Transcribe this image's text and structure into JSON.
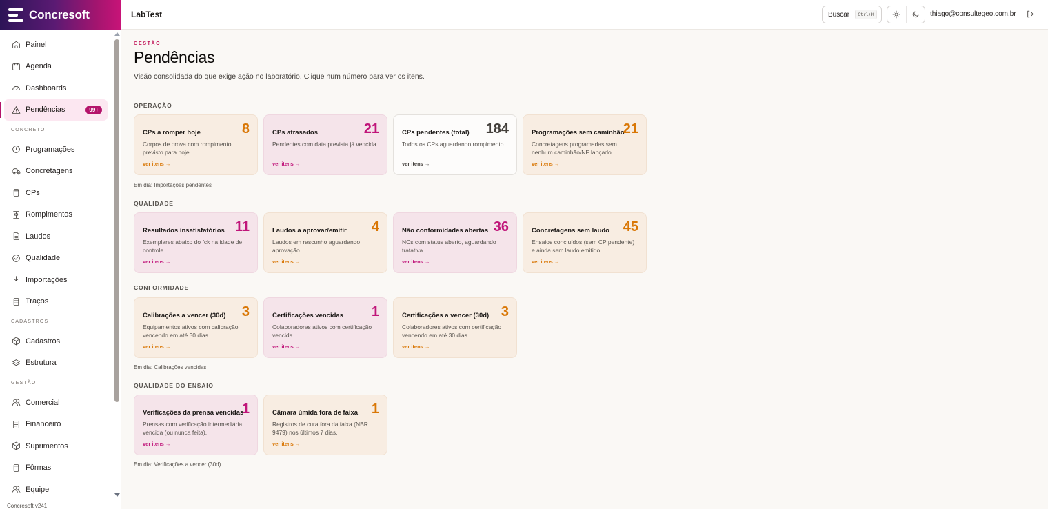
{
  "brand": {
    "name": "Concresoft"
  },
  "topbar": {
    "app_title": "LabTest",
    "search_label": "Buscar",
    "search_shortcut": "Ctrl+K",
    "user_email": "thiago@consultegeo.com.br"
  },
  "sidebar": {
    "items_top": [
      {
        "label": "Painel",
        "icon": "home-icon"
      },
      {
        "label": "Agenda",
        "icon": "calendar-icon"
      },
      {
        "label": "Dashboards",
        "icon": "gauge-icon"
      },
      {
        "label": "Pendências",
        "icon": "alert-triangle-icon",
        "badge": "99+",
        "active": true
      }
    ],
    "section_concreto": "CONCRETO",
    "items_concreto": [
      {
        "label": "Programações",
        "icon": "clock-icon"
      },
      {
        "label": "Concretagens",
        "icon": "truck-icon"
      },
      {
        "label": "CPs",
        "icon": "cylinder-icon"
      },
      {
        "label": "Rompimentos",
        "icon": "press-icon"
      },
      {
        "label": "Laudos",
        "icon": "document-icon"
      },
      {
        "label": "Qualidade",
        "icon": "check-circle-icon"
      },
      {
        "label": "Importações",
        "icon": "download-icon"
      },
      {
        "label": "Traços",
        "icon": "columns-icon"
      }
    ],
    "section_cadastros": "CADASTROS",
    "items_cadastros": [
      {
        "label": "Cadastros",
        "icon": "box-icon"
      },
      {
        "label": "Estrutura",
        "icon": "layers-icon"
      }
    ],
    "section_gestao": "GESTÃO",
    "items_gestao": [
      {
        "label": "Comercial",
        "icon": "users-icon"
      },
      {
        "label": "Financeiro",
        "icon": "receipt-icon"
      },
      {
        "label": "Suprimentos",
        "icon": "package-icon"
      },
      {
        "label": "Fôrmas",
        "icon": "cylinder-icon"
      },
      {
        "label": "Equipe",
        "icon": "users-icon"
      }
    ],
    "version": "Concresoft v241"
  },
  "page": {
    "eyebrow": "GESTÃO",
    "title": "Pendências",
    "subtitle": "Visão consolidada do que exige ação no laboratório. Clique num número para ver os itens."
  },
  "sections": {
    "operacao": {
      "title": "OPERAÇÃO",
      "footnote": "Em dia: Importações pendentes",
      "cards": [
        {
          "title": "CPs a romper hoje",
          "value": "8",
          "desc": "Corpos de prova com rompimento previsto para hoje.",
          "link": "ver itens →",
          "tone": "orange"
        },
        {
          "title": "CPs atrasados",
          "value": "21",
          "desc": "Pendentes com data prevista já vencida.",
          "link": "ver itens →",
          "tone": "pink"
        },
        {
          "title": "CPs pendentes (total)",
          "value": "184",
          "desc": "Todos os CPs aguardando rompimento.",
          "link": "ver itens →",
          "tone": "white"
        },
        {
          "title": "Programações sem caminhão",
          "value": "21",
          "desc": "Concretagens programadas sem nenhum caminhão/NF lançado.",
          "link": "ver itens →",
          "tone": "orange"
        }
      ]
    },
    "qualidade": {
      "title": "QUALIDADE",
      "cards": [
        {
          "title": "Resultados insatisfatórios",
          "value": "11",
          "desc": "Exemplares abaixo do fck na idade de controle.",
          "link": "ver itens →",
          "tone": "pink"
        },
        {
          "title": "Laudos a aprovar/emitir",
          "value": "4",
          "desc": "Laudos em rascunho aguardando aprovação.",
          "link": "ver itens →",
          "tone": "orange"
        },
        {
          "title": "Não conformidades abertas",
          "value": "36",
          "desc": "NCs com status aberto, aguardando tratativa.",
          "link": "ver itens →",
          "tone": "pink"
        },
        {
          "title": "Concretagens sem laudo",
          "value": "45",
          "desc": "Ensaios concluídos (sem CP pendente) e ainda sem laudo emitido.",
          "link": "ver itens →",
          "tone": "orange"
        }
      ]
    },
    "conformidade": {
      "title": "CONFORMIDADE",
      "footnote": "Em dia: Calibrações vencidas",
      "cards": [
        {
          "title": "Calibrações a vencer (30d)",
          "value": "3",
          "desc": "Equipamentos ativos com calibração vencendo em até 30 dias.",
          "link": "ver itens →",
          "tone": "orange"
        },
        {
          "title": "Certificações vencidas",
          "value": "1",
          "desc": "Colaboradores ativos com certificação vencida.",
          "link": "ver itens →",
          "tone": "pink"
        },
        {
          "title": "Certificações a vencer (30d)",
          "value": "3",
          "desc": "Colaboradores ativos com certificação vencendo em até 30 dias.",
          "link": "ver itens →",
          "tone": "orange"
        }
      ]
    },
    "qualidade_ensaio": {
      "title": "QUALIDADE DO ENSAIO",
      "footnote": "Em dia: Verificações a vencer (30d)",
      "cards": [
        {
          "title": "Verificações da prensa vencidas",
          "value": "1",
          "desc": "Prensas com verificação intermediária vencida (ou nunca feita).",
          "link": "ver itens →",
          "tone": "pink"
        },
        {
          "title": "Câmara úmida fora de faixa",
          "value": "1",
          "desc": "Registros de cura fora da faixa (NBR 9479) nos últimos 7 dias.",
          "link": "ver itens →",
          "tone": "orange"
        }
      ]
    }
  }
}
